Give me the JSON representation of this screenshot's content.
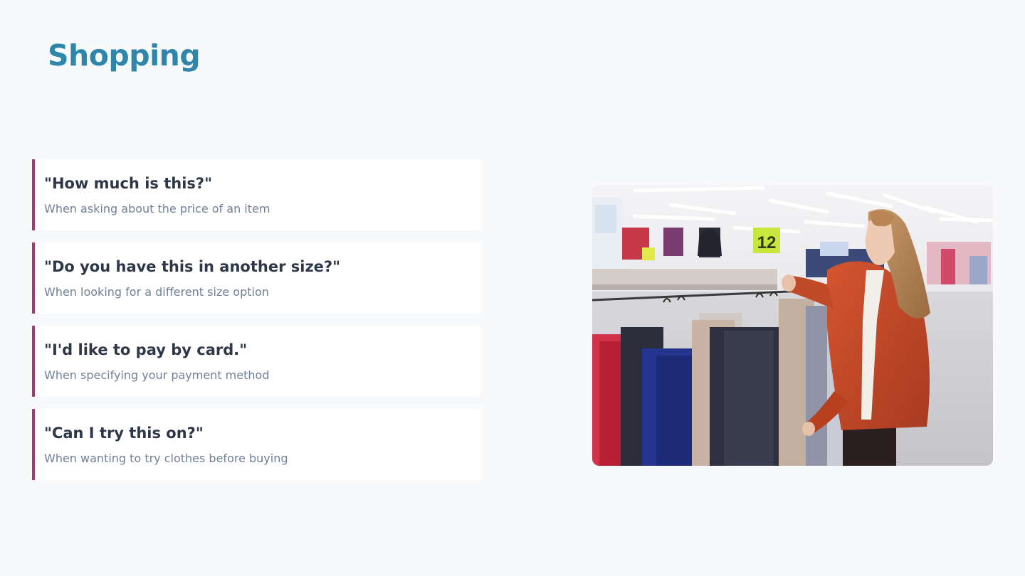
{
  "slide": {
    "title": "Shopping"
  },
  "phrases": [
    {
      "phrase": "\"How much is this?\"",
      "context": "When asking about the price of an item"
    },
    {
      "phrase": "\"Do you have this in another size?\"",
      "context": "When looking for a different size option"
    },
    {
      "phrase": "\"I'd like to pay by card.\"",
      "context": "When specifying your payment method"
    },
    {
      "phrase": "\"Can I try this on?\"",
      "context": "When wanting to try clothes before buying"
    }
  ],
  "photo": {
    "subject": "woman-browsing-clothing-rack",
    "sign_number": "12",
    "colors": {
      "accent": "#a23b72",
      "title": "#2e86ab",
      "sign": "#c8e63c",
      "cardigan": "#c8482a"
    }
  }
}
